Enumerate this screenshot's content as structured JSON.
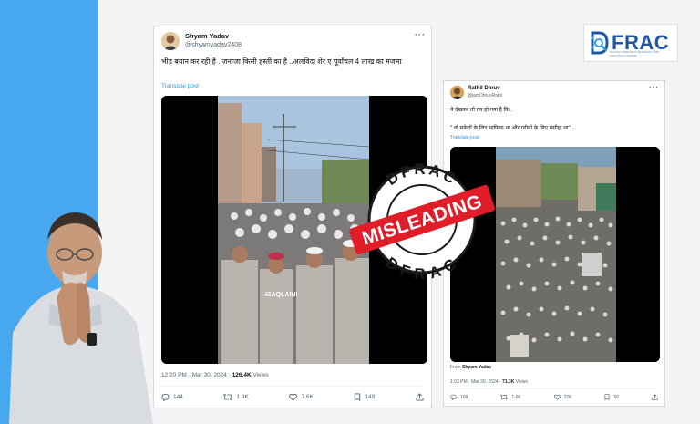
{
  "logo": {
    "text": "FRAC",
    "subtitle": "DIGITAL FORENSICS RESEARCH AND ANALYTICS CENTRE",
    "brand_color": "#1f57a6"
  },
  "stamp": {
    "label": "MISLEADING",
    "ring_text_top": "DFRAC",
    "ring_text_bottom": "DFRAC",
    "color": "#e11d2a"
  },
  "tweet1": {
    "name": "Shyam Yadav",
    "handle": "@shyamyadav2408",
    "text": "भीड़ बयान कर रही है ..जनाजा किसी हस्ती का है ..अलविदा शेर ए पूर्वांचल 4 लाख का मजमा",
    "translate": "Translate post",
    "watermark": "ISAQLAINI",
    "time": "12:20 PM · Mar 30, 2024 · ",
    "views_count": "126.4K",
    "views_label": " Views",
    "replies": "144",
    "reposts": "1.8K",
    "likes": "7.6K",
    "bookmarks": "149"
  },
  "tweet2": {
    "name": "Rathil Dhruv",
    "handle": "@iamDhruvRathi",
    "text1": "ये देखकर तो तय हो गया है कि..",
    "text2": "\" वो सफ़ेदों के लिए माफिया था और गरीबों के लिए मसीहा था\" ...",
    "translate": "Translate post",
    "from_label": "From ",
    "from_name": "Shyam Yadav",
    "time": "1:03 PM · Mar 30, 2024 · ",
    "views_count": "71.3K",
    "views_label": " Views",
    "replies": "168",
    "reposts": "1.6K",
    "likes": "22K",
    "bookmarks": "60"
  },
  "colors": {
    "left_panel": "#47a8f0",
    "link": "#1d9bf0"
  }
}
